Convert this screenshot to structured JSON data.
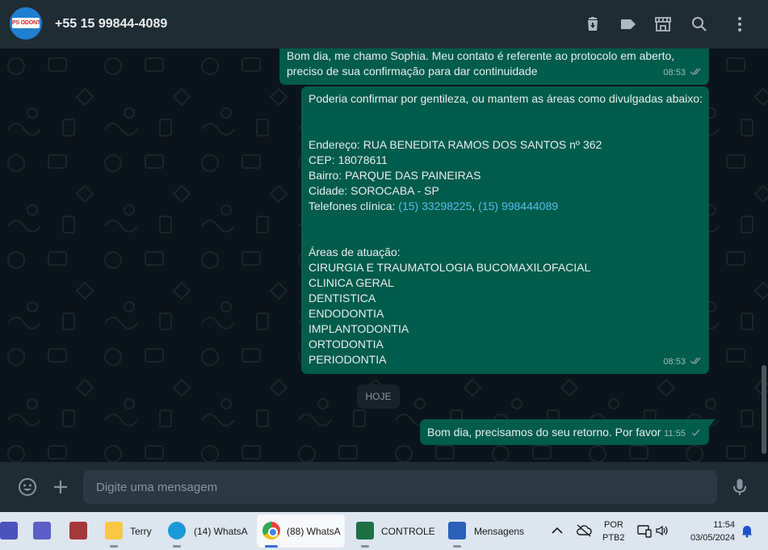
{
  "header": {
    "avatar_text": "PS ODONTO",
    "contact_name": "+55 15 99844-4089",
    "icons": [
      "delete-icon",
      "label-icon",
      "store-icon",
      "search-icon",
      "menu-icon"
    ]
  },
  "messages": [
    {
      "lines": [
        "Bom dia, me chamo Sophia. Meu contato é referente ao protocolo em aberto,",
        "preciso de sua confirmação para dar continuidade"
      ],
      "time": "08:53",
      "status": "read"
    },
    {
      "intro": "Poderia confirmar por gentileza, ou mantem as áreas como divulgadas abaixo:",
      "address": "Endereço: RUA BENEDITA RAMOS DOS SANTOS nº 362",
      "cep": "CEP: 18078611",
      "bairro": "Bairro: PARQUE DAS PAINEIRAS",
      "cidade": "Cidade: SOROCABA - SP",
      "phones_label": "Telefones clínica: ",
      "phone1": "(15) 33298225",
      "phone_sep": ", ",
      "phone2": "(15) 998444089",
      "areas_title": "Áreas de atuação:",
      "areas": [
        "CIRURGIA E TRAUMATOLOGIA BUCOMAXILOFACIAL",
        "CLINICA GERAL",
        "DENTISTICA",
        "ENDODONTIA",
        "IMPLANTODONTIA",
        "ORTODONTIA",
        "PERIODONTIA"
      ],
      "time": "08:53",
      "status": "read"
    },
    {
      "text": "Bom dia, precisamos do seu retorno. Por favor",
      "time": "11:55",
      "status": "sent"
    }
  ],
  "date_chip": "HOJE",
  "composer": {
    "placeholder": "Digite uma mensagem",
    "icons": [
      "emoji-icon",
      "attach-plus-icon",
      "microphone-icon"
    ]
  },
  "taskbar": {
    "apps": [
      {
        "name": "Teams",
        "label": ""
      },
      {
        "name": "Teams (new)",
        "label": ""
      },
      {
        "name": "Access",
        "label": ""
      },
      {
        "name": "File Explorer",
        "label": "Terry"
      },
      {
        "name": "Edge",
        "label": "(14) WhatsA"
      },
      {
        "name": "Chrome",
        "label": "(88) WhatsA"
      },
      {
        "name": "Excel",
        "label": "CONTROLE"
      },
      {
        "name": "Word",
        "label": "Mensagens"
      }
    ],
    "lang_line1": "POR",
    "lang_line2": "PTB2",
    "time": "11:54",
    "date": "03/05/2024"
  },
  "colors": {
    "outgoing_bubble": "#005c4b",
    "header_bg": "#202c33",
    "chat_bg": "#0b141a",
    "link": "#53bdeb",
    "read_tick": "#8696a0"
  }
}
